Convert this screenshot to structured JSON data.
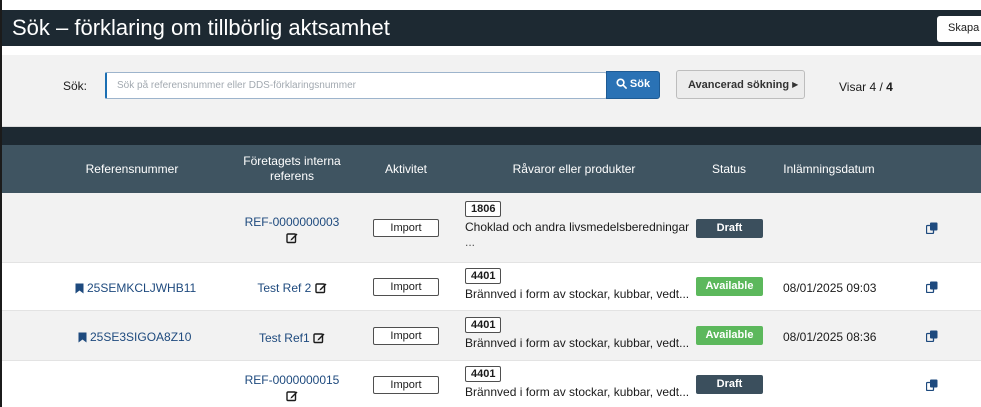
{
  "header": {
    "title": "Sök – förklaring om tillbörlig aktsamhet",
    "create_label": "Skapa"
  },
  "search": {
    "label": "Sök:",
    "placeholder": "Sök på referensnummer eller DDS-förklaringsnummer",
    "value": "",
    "button_label": "Sök",
    "advanced_label": "Avancerad sökning",
    "results_prefix": "Visar 4 / ",
    "results_total": "4"
  },
  "table": {
    "columns": {
      "reference": "Referensnummer",
      "internal_line1": "Företagets interna",
      "internal_line2": "referens",
      "activity": "Aktivitet",
      "products": "Råvaror eller produkter",
      "status": "Status",
      "submitted": "Inlämningsdatum"
    },
    "rows": [
      {
        "reference": "",
        "internal_ref": "REF-0000000003",
        "activity": "Import",
        "product_code": "1806",
        "product_desc": "Choklad och andra livsmedelsberedningar",
        "product_more": "...",
        "status": "Draft",
        "submitted": ""
      },
      {
        "reference": "25SEMKCLJWHB11",
        "internal_ref": "Test Ref 2",
        "activity": "Import",
        "product_code": "4401",
        "product_desc": "Brännved i form av stockar, kubbar, vedt...",
        "status": "Available",
        "submitted": "08/01/2025 09:03"
      },
      {
        "reference": "25SE3SIGOA8Z10",
        "internal_ref": "Test Ref1",
        "activity": "Import",
        "product_code": "4401",
        "product_desc": "Brännved i form av stockar, kubbar, vedt...",
        "status": "Available",
        "submitted": "08/01/2025 08:36"
      },
      {
        "reference": "",
        "internal_ref": "REF-0000000015",
        "activity": "Import",
        "product_code": "4401",
        "product_desc": "Brännved i form av stockar, kubbar, vedt...",
        "status": "Draft",
        "submitted": ""
      }
    ]
  },
  "icons": {
    "bookmark": "bookmark-icon",
    "edit": "edit-icon",
    "copy": "copy-icon",
    "search": "search-icon"
  },
  "colors": {
    "header_bg": "#1d2932",
    "table_header_bg": "#3f5461",
    "link": "#1e4a7e",
    "primary_button": "#2a72b5",
    "draft": "#3b4f5d",
    "available": "#5cb85c"
  }
}
